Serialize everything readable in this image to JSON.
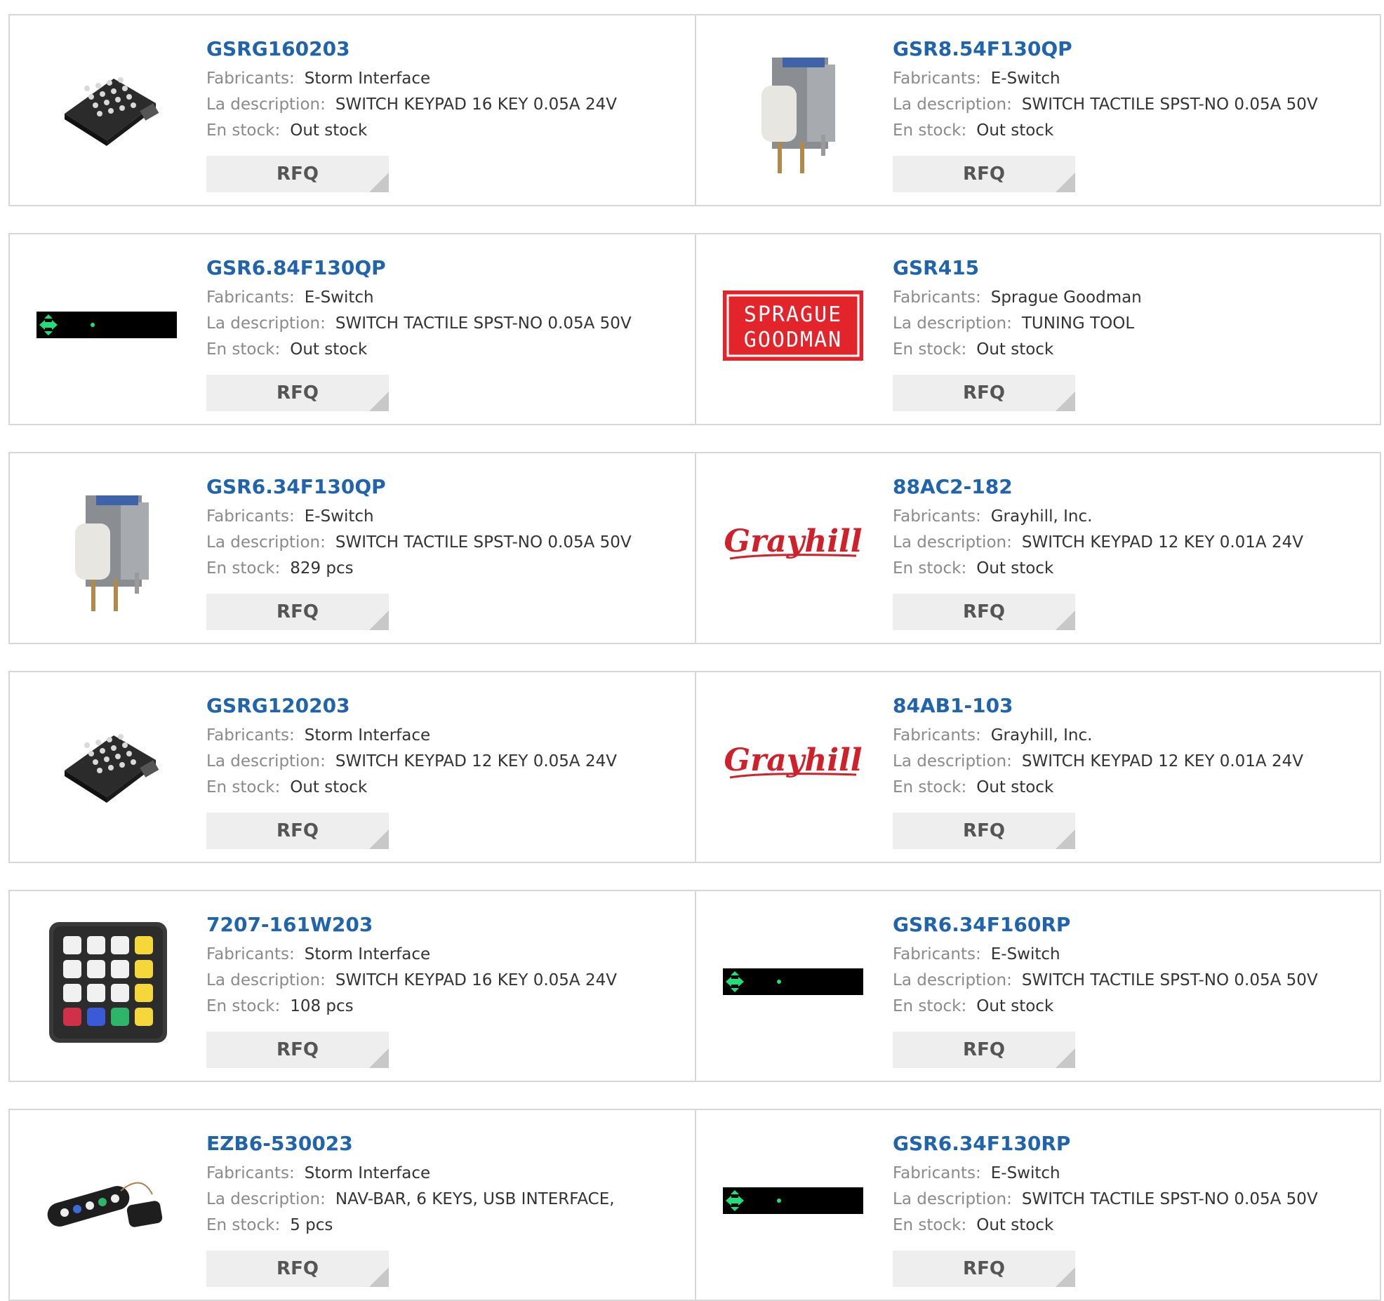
{
  "labels": {
    "manufacturer": "Fabricants:",
    "description": "La description:",
    "stock": "En stock:",
    "rfq": "RFQ"
  },
  "colors": {
    "link": "#1f64ad",
    "border": "#d7d7d7",
    "button_bg": "#eeeeee"
  },
  "products": [
    {
      "part": "GSRG160203",
      "manufacturer": "Storm Interface",
      "description": "SWITCH KEYPAD 16 KEY 0.05A 24V",
      "stock": "Out stock",
      "image": "small-keypad"
    },
    {
      "part": "GSR8.54F130QP",
      "manufacturer": "E-Switch",
      "description": "SWITCH TACTILE SPST-NO 0.05A 50V",
      "stock": "Out stock",
      "image": "tactile-switch"
    },
    {
      "part": "GSR6.84F130QP",
      "manufacturer": "E-Switch",
      "description": "SWITCH TACTILE SPST-NO 0.05A 50V",
      "stock": "Out stock",
      "image": "placeholder-bar"
    },
    {
      "part": "GSR415",
      "manufacturer": "Sprague Goodman",
      "description": "TUNING TOOL",
      "stock": "Out stock",
      "image": "sprague-goodman-logo",
      "logo_text": [
        "SPRAGUE",
        "GOODMAN"
      ]
    },
    {
      "part": "GSR6.34F130QP",
      "manufacturer": "E-Switch",
      "description": "SWITCH TACTILE SPST-NO 0.05A 50V",
      "stock": "829 pcs",
      "image": "tactile-switch"
    },
    {
      "part": "88AC2-182",
      "manufacturer": "Grayhill, Inc.",
      "description": "SWITCH KEYPAD 12 KEY 0.01A 24V",
      "stock": "Out stock",
      "image": "grayhill-logo",
      "logo_text": "Grayhill"
    },
    {
      "part": "GSRG120203",
      "manufacturer": "Storm Interface",
      "description": "SWITCH KEYPAD 12 KEY 0.05A 24V",
      "stock": "Out stock",
      "image": "small-keypad"
    },
    {
      "part": "84AB1-103",
      "manufacturer": "Grayhill, Inc.",
      "description": "SWITCH KEYPAD 12 KEY 0.01A 24V",
      "stock": "Out stock",
      "image": "grayhill-logo",
      "logo_text": "Grayhill"
    },
    {
      "part": "7207-161W203",
      "manufacturer": "Storm Interface",
      "description": "SWITCH KEYPAD 16 KEY 0.05A 24V",
      "stock": "108 pcs",
      "image": "large-keypad"
    },
    {
      "part": "GSR6.34F160RP",
      "manufacturer": "E-Switch",
      "description": "SWITCH TACTILE SPST-NO 0.05A 50V",
      "stock": "Out stock",
      "image": "placeholder-bar"
    },
    {
      "part": "EZB6-530023",
      "manufacturer": "Storm Interface",
      "description": "NAV-BAR, 6 KEYS, USB INTERFACE,",
      "stock": "5 pcs",
      "image": "nav-bar"
    },
    {
      "part": "GSR6.34F130RP",
      "manufacturer": "E-Switch",
      "description": "SWITCH TACTILE SPST-NO 0.05A 50V",
      "stock": "Out stock",
      "image": "placeholder-bar"
    }
  ]
}
